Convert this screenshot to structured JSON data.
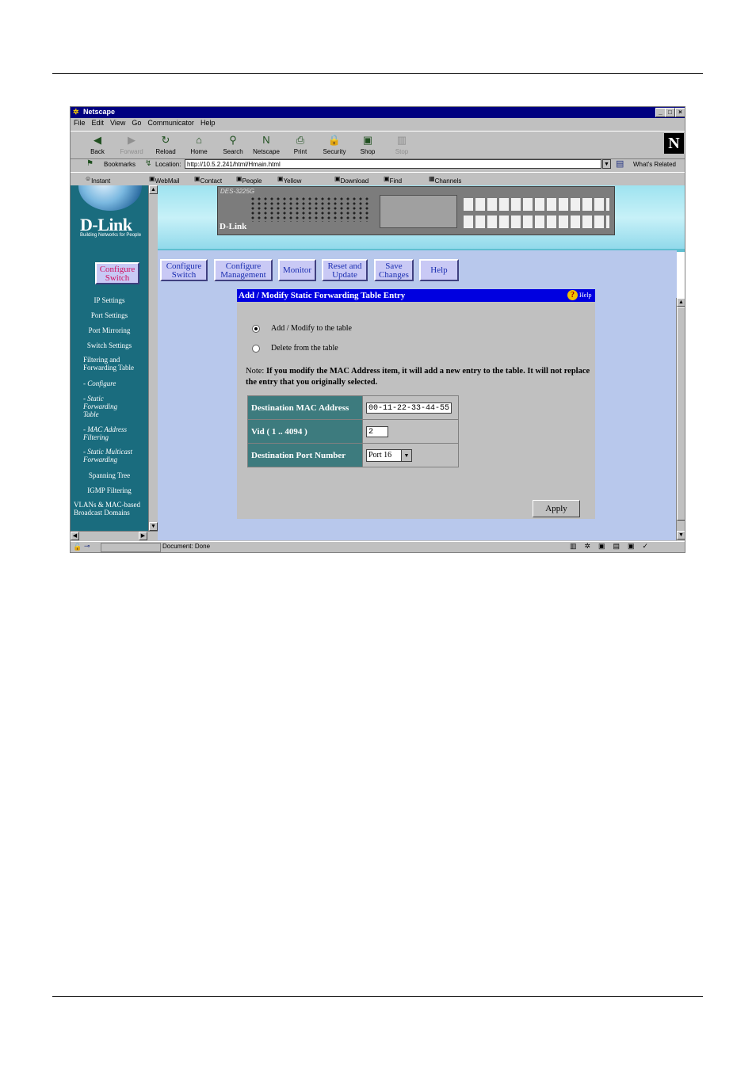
{
  "window": {
    "title": "Netscape"
  },
  "menu": [
    "File",
    "Edit",
    "View",
    "Go",
    "Communicator",
    "Help"
  ],
  "toolbar": [
    {
      "label": "Back",
      "icon": "back-arrow-icon",
      "enabled": true
    },
    {
      "label": "Forward",
      "icon": "forward-arrow-icon",
      "enabled": false
    },
    {
      "label": "Reload",
      "icon": "reload-icon",
      "enabled": true
    },
    {
      "label": "Home",
      "icon": "home-icon",
      "enabled": true
    },
    {
      "label": "Search",
      "icon": "search-icon",
      "enabled": true
    },
    {
      "label": "Netscape",
      "icon": "netscape-icon",
      "enabled": true
    },
    {
      "label": "Print",
      "icon": "printer-icon",
      "enabled": true
    },
    {
      "label": "Security",
      "icon": "lock-icon",
      "enabled": true
    },
    {
      "label": "Shop",
      "icon": "shop-icon",
      "enabled": true
    },
    {
      "label": "Stop",
      "icon": "stop-icon",
      "enabled": false
    }
  ],
  "location": {
    "bookmarks_label": "Bookmarks",
    "label": "Location:",
    "url": "http://10.5.2.241/html/Hmain.html",
    "whats_related": "What's Related"
  },
  "links": [
    "Instant Message",
    "WebMail",
    "Contact",
    "People",
    "Yellow Pages",
    "Download",
    "Find Sites",
    "Channels"
  ],
  "brand": {
    "logo": "D-Link",
    "tagline": "Building Networks for People"
  },
  "sidebar": {
    "configure_switch": "Configure Switch",
    "items": [
      {
        "label": "IP Settings",
        "sub": false
      },
      {
        "label": "Port Settings",
        "sub": false
      },
      {
        "label": "Port Mirroring",
        "sub": false
      },
      {
        "label": "Switch Settings",
        "sub": false
      },
      {
        "label": "Filtering and Forwarding Table",
        "sub": false
      },
      {
        "label": "- Configure",
        "sub": true
      },
      {
        "label": "- Static Forwarding Table",
        "sub": true
      },
      {
        "label": "- MAC Address Filtering",
        "sub": true
      },
      {
        "label": "- Static Multicast Forwarding",
        "sub": true
      },
      {
        "label": "Spanning Tree",
        "sub": false
      },
      {
        "label": "IGMP Filtering",
        "sub": false
      },
      {
        "label": "VLANs & MAC-based Broadcast Domains",
        "sub": false
      }
    ]
  },
  "nav": [
    {
      "line1": "Configure",
      "line2": "Switch"
    },
    {
      "line1": "Configure",
      "line2": "Management"
    },
    {
      "line1": "Monitor",
      "line2": ""
    },
    {
      "line1": "Reset and",
      "line2": "Update"
    },
    {
      "line1": "Save",
      "line2": "Changes"
    },
    {
      "line1": "Help",
      "line2": ""
    }
  ],
  "device": {
    "model": "DES-3225G",
    "logo": "D-Link"
  },
  "panel": {
    "title": "Add / Modify Static Forwarding Table Entry",
    "help": "Help",
    "options": [
      {
        "label": "Add / Modify to the table",
        "selected": true
      },
      {
        "label": "Delete from the table",
        "selected": false
      }
    ],
    "note_prefix": "Note: ",
    "note": "If you modify the MAC Address item, it will add a new entry to the table. It will not replace the entry that you originally selected.",
    "fields": {
      "mac_label": "Destination MAC Address",
      "mac_value": "00-11-22-33-44-55",
      "vid_label": "Vid ( 1 .. 4094 )",
      "vid_value": "2",
      "port_label": "Destination Port Number",
      "port_value": "Port 16"
    },
    "apply": "Apply"
  },
  "status": {
    "text": "Document: Done"
  }
}
